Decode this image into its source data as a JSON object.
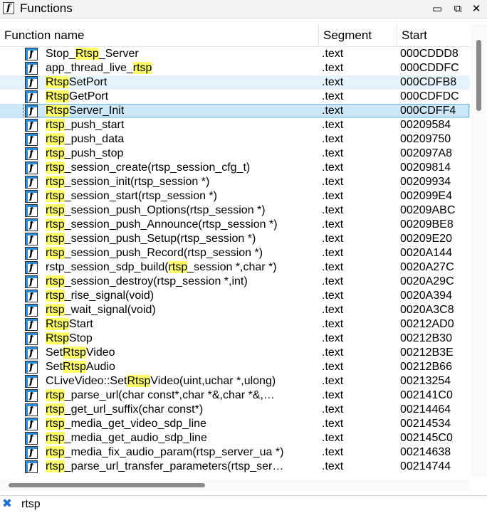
{
  "window": {
    "title": "Functions",
    "icon": "function-icon",
    "buttons": [
      "restore-icon",
      "float-icon",
      "close-icon"
    ]
  },
  "table": {
    "columns": [
      "Function name",
      "Segment",
      "Start"
    ],
    "rows": [
      {
        "name": "Stop_Rtsp_Server",
        "segment": ".text",
        "start": "000CDDD8",
        "state": ""
      },
      {
        "name": "app_thread_live_rtsp",
        "segment": ".text",
        "start": "000CDDFC",
        "state": ""
      },
      {
        "name": "RtspSetPort",
        "segment": ".text",
        "start": "000CDFB8",
        "state": "hover"
      },
      {
        "name": "RtspGetPort",
        "segment": ".text",
        "start": "000CDFDC",
        "state": ""
      },
      {
        "name": "RtspServer_Init",
        "segment": ".text",
        "start": "000CDFF4",
        "state": "selected"
      },
      {
        "name": "rtsp_push_start",
        "segment": ".text",
        "start": "00209584",
        "state": ""
      },
      {
        "name": "rtsp_push_data",
        "segment": ".text",
        "start": "00209750",
        "state": ""
      },
      {
        "name": "rtsp_push_stop",
        "segment": ".text",
        "start": "002097A8",
        "state": ""
      },
      {
        "name": "rtsp_session_create(rtsp_session_cfg_t)",
        "segment": ".text",
        "start": "00209814",
        "state": ""
      },
      {
        "name": "rtsp_session_init(rtsp_session *)",
        "segment": ".text",
        "start": "00209934",
        "state": ""
      },
      {
        "name": "rtsp_session_start(rtsp_session *)",
        "segment": ".text",
        "start": "002099E4",
        "state": ""
      },
      {
        "name": "rtsp_session_push_Options(rtsp_session *)",
        "segment": ".text",
        "start": "00209ABC",
        "state": ""
      },
      {
        "name": "rtsp_session_push_Announce(rtsp_session *)",
        "segment": ".text",
        "start": "00209BE8",
        "state": ""
      },
      {
        "name": "rtsp_session_push_Setup(rtsp_session *)",
        "segment": ".text",
        "start": "00209E20",
        "state": ""
      },
      {
        "name": "rtsp_session_push_Record(rtsp_session *)",
        "segment": ".text",
        "start": "0020A144",
        "state": ""
      },
      {
        "name": "rstp_session_sdp_build(rtsp_session *,char *)",
        "segment": ".text",
        "start": "0020A27C",
        "state": ""
      },
      {
        "name": "rtsp_session_destroy(rtsp_session *,int)",
        "segment": ".text",
        "start": "0020A29C",
        "state": ""
      },
      {
        "name": "rtsp_rise_signal(void)",
        "segment": ".text",
        "start": "0020A394",
        "state": ""
      },
      {
        "name": "rtsp_wait_signal(void)",
        "segment": ".text",
        "start": "0020A3C8",
        "state": ""
      },
      {
        "name": "RtspStart",
        "segment": ".text",
        "start": "00212AD0",
        "state": ""
      },
      {
        "name": "RtspStop",
        "segment": ".text",
        "start": "00212B30",
        "state": ""
      },
      {
        "name": "SetRtspVideo",
        "segment": ".text",
        "start": "00212B3E",
        "state": ""
      },
      {
        "name": "SetRtspAudio",
        "segment": ".text",
        "start": "00212B66",
        "state": ""
      },
      {
        "name": "CLiveVideo::SetRtspVideo(uint,uchar *,ulong)",
        "segment": ".text",
        "start": "00213254",
        "state": ""
      },
      {
        "name": "rtsp_parse_url(char const*,char *&,char *&,…",
        "segment": ".text",
        "start": "002141C0",
        "state": ""
      },
      {
        "name": "rtsp_get_url_suffix(char const*)",
        "segment": ".text",
        "start": "00214464",
        "state": ""
      },
      {
        "name": "rtsp_media_get_video_sdp_line",
        "segment": ".text",
        "start": "00214534",
        "state": ""
      },
      {
        "name": "rtsp_media_get_audio_sdp_line",
        "segment": ".text",
        "start": "002145C0",
        "state": ""
      },
      {
        "name": "rtsp_media_fix_audio_param(rtsp_server_ua *)",
        "segment": ".text",
        "start": "00214638",
        "state": ""
      },
      {
        "name": "rtsp_parse_url_transfer_parameters(rtsp_ser…",
        "segment": ".text",
        "start": "00214744",
        "state": ""
      }
    ]
  },
  "filter": {
    "value": "rtsp",
    "close_icon": "close-filter-icon"
  },
  "colors": {
    "highlight": "#ffff66",
    "selected": "#cce8f8",
    "hover": "#e5f3fb",
    "icon_accent": "#2c8fd9"
  }
}
